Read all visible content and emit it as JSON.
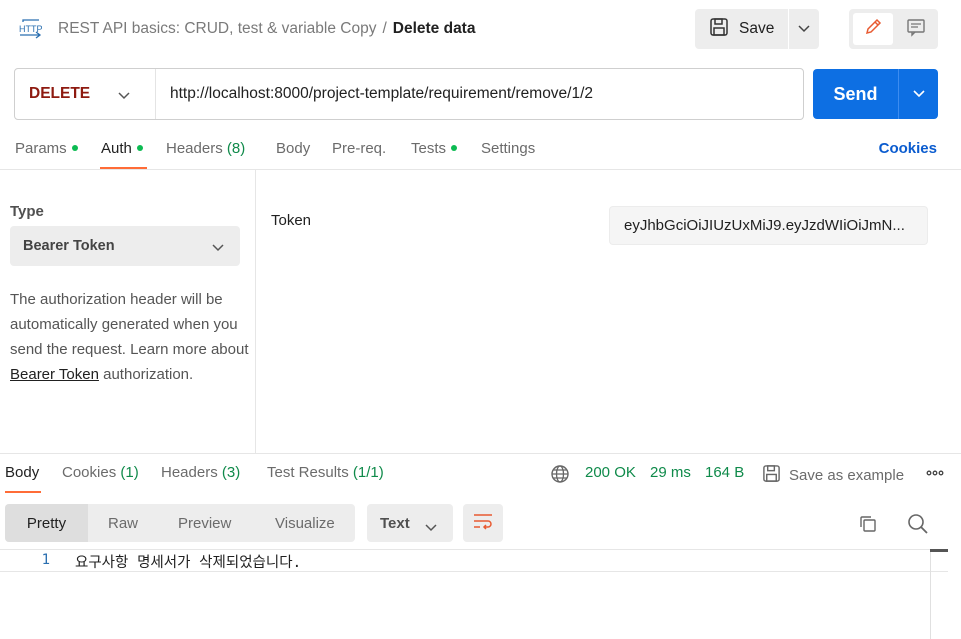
{
  "header": {
    "http_badge": "HTTP",
    "collection": "REST API basics: CRUD, test & variable Copy",
    "separator": "/",
    "request_name": "Delete data",
    "save_label": "Save"
  },
  "request": {
    "method": "DELETE",
    "url": "http://localhost:8000/project-template/requirement/remove/1/2",
    "send_label": "Send"
  },
  "request_tabs": {
    "params": "Params",
    "auth": "Auth",
    "headers": "Headers",
    "headers_count": "(8)",
    "body": "Body",
    "prereq": "Pre-req.",
    "tests": "Tests",
    "settings": "Settings",
    "cookies": "Cookies"
  },
  "auth": {
    "type_label": "Type",
    "type_value": "Bearer Token",
    "description_pre": "The authorization header will be automatically generated when you send the request. Learn more about ",
    "description_link": "Bearer Token",
    "description_post": " authorization.",
    "token_label": "Token",
    "token_value": "eyJhbGciOiJIUzUxMiJ9.eyJzdWIiOiJmN..."
  },
  "response_tabs": {
    "body": "Body",
    "cookies": "Cookies",
    "cookies_count": "(1)",
    "headers": "Headers",
    "headers_count": "(3)",
    "test_results": "Test Results",
    "test_results_count": "(1/1)"
  },
  "response_meta": {
    "status": "200 OK",
    "time": "29 ms",
    "size": "164 B",
    "save_example": "Save as example"
  },
  "response_view": {
    "pretty": "Pretty",
    "raw": "Raw",
    "preview": "Preview",
    "visualize": "Visualize",
    "format": "Text"
  },
  "response_body": {
    "line_number": "1",
    "line_text": "요구사항 명세서가 삭제되었습니다."
  },
  "colors": {
    "method_delete": "#8e1a10",
    "send_button": "#0d6fe3",
    "accent_underline": "#ff6c37",
    "status_green": "#0f8a4a",
    "link_blue": "#0b5ccf"
  },
  "icons": {
    "request_type": "http-icon",
    "save": "floppy-disk-icon",
    "edit": "pencil-icon",
    "docs": "comment-icon",
    "network": "globe-icon",
    "wrap": "wrap-lines-icon",
    "copy": "copy-icon",
    "search": "search-icon",
    "more": "more-horizontal-icon"
  }
}
